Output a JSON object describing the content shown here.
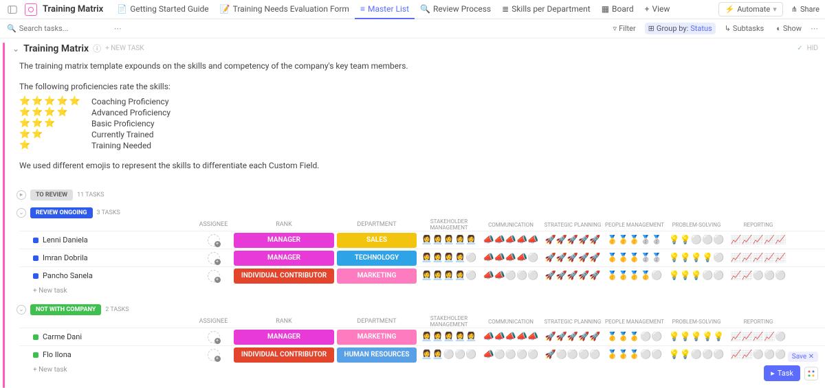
{
  "nav": {
    "title": "Training Matrix",
    "tabs": [
      {
        "label": "Getting Started Guide",
        "icon": "doc"
      },
      {
        "label": "Training Needs Evaluation Form",
        "icon": "form"
      },
      {
        "label": "Master List",
        "icon": "list",
        "active": true
      },
      {
        "label": "Review Process",
        "icon": "review"
      },
      {
        "label": "Skills per Department",
        "icon": "skills"
      },
      {
        "label": "Board",
        "icon": "board"
      },
      {
        "label": "View",
        "icon": "plus"
      }
    ],
    "automate": "Automate",
    "share": "Share"
  },
  "toolbar": {
    "search_placeholder": "Search tasks...",
    "filter": "Filter",
    "groupby_label": "Group by:",
    "groupby_value": "Status",
    "subtasks": "Subtasks",
    "show": "Show"
  },
  "doc": {
    "title": "Training Matrix",
    "newtask": "+ NEW TASK",
    "hide": "HID",
    "desc1": "The training matrix template expounds on the skills and competency of the company's key team members.",
    "desc2": "The following proficiencies rate the skills:",
    "profs": [
      {
        "stars": "⭐⭐⭐⭐⭐",
        "label": "Coaching Proficiency"
      },
      {
        "stars": "⭐⭐⭐⭐",
        "label": "Advanced Proficiency"
      },
      {
        "stars": "⭐⭐⭐",
        "label": "Basic Proficiency"
      },
      {
        "stars": "⭐⭐",
        "label": "Currently Trained"
      },
      {
        "stars": "⭐",
        "label": "Training Needed"
      }
    ],
    "desc3": "We used different emojis to represent the skills to differentiate each Custom Field."
  },
  "standalone_status": {
    "label": "TO REVIEW",
    "count": "11 TASKS"
  },
  "columns": {
    "assignee": "ASSIGNEE",
    "rank": "RANK",
    "department": "DEPARTMENT",
    "skills": [
      "STAKEHOLDER MANAGEMENT",
      "COMMUNICATION",
      "STRATEGIC PLANNING",
      "PEOPLE MANAGEMENT",
      "PROBLEM-SOLVING",
      "REPORTING"
    ]
  },
  "groups": [
    {
      "label": "REVIEW ONGOING",
      "color": "blue",
      "count": "3 TASKS",
      "sq": "#2f5bea",
      "rows": [
        {
          "name": "Lenni Daniela",
          "rank": "MANAGER",
          "rank_bg": "#e83ad6",
          "dept": "SALES",
          "dept_bg": "#f2c40f",
          "skills": [
            "👩‍💼👩‍💼👩‍💼👩‍💼👩‍💼",
            "📣📣📣📣📣",
            "🚀🚀🚀🚀🚀",
            "🥇🥇🥇🥈🥈",
            "💡💡⚪⚪⚪",
            "📈📈📈📈📈"
          ]
        },
        {
          "name": "Imran Dobrila",
          "rank": "MANAGER",
          "rank_bg": "#e83ad6",
          "dept": "TECHNOLOGY",
          "dept_bg": "#2ea3e6",
          "skills": [
            "👩‍💼👩‍💼👩‍💼👩‍💼⚪",
            "📣📣📣📣⚪",
            "🚀🚀🚀🚀🚀",
            "🥇🥇🥇🥈🥈",
            "💡💡💡💡⚪",
            "📈📈📈📈📈"
          ]
        },
        {
          "name": "Pancho Sanela",
          "rank": "INDIVIDUAL CONTRIBUTOR",
          "rank_bg": "#e2452b",
          "dept": "MARKETING",
          "dept_bg": "#ff7bbf",
          "skills": [
            "👩‍💼👩‍💼👩‍💼👩‍💼⚪",
            "📣📣⚪⚪⚪",
            "🚀🚀🚀🚀🚀",
            "🥇🥇🥇🥇⚪",
            "💡💡💡⚪⚪",
            "📈📈⚪⚪⚪"
          ]
        }
      ]
    },
    {
      "label": "NOT WITH COMPANY",
      "color": "green",
      "count": "2 TASKS",
      "sq": "#3fbf4e",
      "rows": [
        {
          "name": "Carme Dani",
          "rank": "MANAGER",
          "rank_bg": "#e83ad6",
          "dept": "MARKETING",
          "dept_bg": "#ff7bbf",
          "skills": [
            "👩‍💼👩‍💼👩‍💼👩‍💼👩‍💼",
            "📣📣📣📣📣",
            "🚀🚀🚀🚀🚀",
            "🥇🥇🥇⚪⚪",
            "💡💡💡💡💡",
            "📈📈📈📈⚪"
          ]
        },
        {
          "name": "Flo Ilona",
          "rank": "INDIVIDUAL CONTRIBUTOR",
          "rank_bg": "#e2452b",
          "dept": "HUMAN RESOURCES",
          "dept_bg": "#5aa0e6",
          "skills": [
            "👩‍💼👩‍💼⚪⚪⚪",
            "📣⚪⚪⚪⚪",
            "🚀⚪⚪⚪⚪",
            "🥇🥇🥇⚪⚪",
            "💡💡⚪⚪⚪",
            "📈📈⚪⚪⚪"
          ]
        }
      ]
    }
  ],
  "newtask_row": "+ New task",
  "fab": {
    "save": "Save ✕",
    "task": "Task"
  }
}
